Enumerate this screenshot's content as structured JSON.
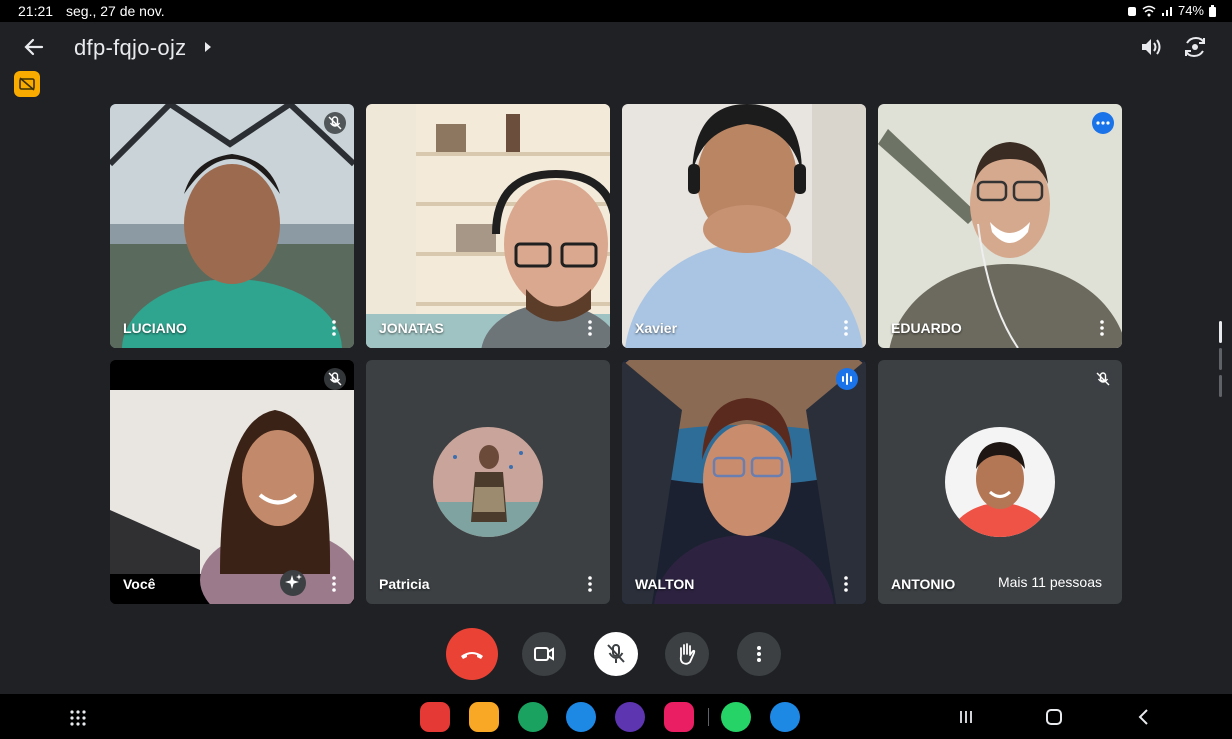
{
  "status_bar": {
    "time": "21:21",
    "date": "seg., 27 de nov.",
    "battery": "74%"
  },
  "header": {
    "meeting_code": "dfp-fqjo-ojz",
    "icons": [
      "back-arrow-icon",
      "speaker-icon",
      "switch-camera-icon"
    ]
  },
  "participants": [
    {
      "name": "LUCIANO",
      "muted": true,
      "speaking": false
    },
    {
      "name": "JONATAS",
      "muted": false,
      "speaking": false
    },
    {
      "name": "Xavier",
      "muted": false,
      "speaking": false
    },
    {
      "name": "EDUARDO",
      "muted": false,
      "speaking": false,
      "indicator": "dots"
    },
    {
      "name": "Você",
      "muted": true,
      "speaking": false
    },
    {
      "name": "Patricia",
      "muted": false,
      "speaking": false
    },
    {
      "name": "WALTON",
      "muted": false,
      "speaking": true
    },
    {
      "name": "ANTONIO",
      "muted": true,
      "speaking": false
    }
  ],
  "more_people_label": "Mais 11 pessoas",
  "controls": [
    "hang-up",
    "camera",
    "microphone-off",
    "raise-hand",
    "more-options"
  ],
  "colors": {
    "background": "#1f2125",
    "tile": "#3c4043",
    "hangup": "#ea4335",
    "accent": "#1a73e8",
    "cc_badge": "#f9ab00"
  },
  "dock_apps": [
    "flipboard",
    "files",
    "phone",
    "messages",
    "internet",
    "camera",
    "whatsapp",
    "meet-upload"
  ]
}
